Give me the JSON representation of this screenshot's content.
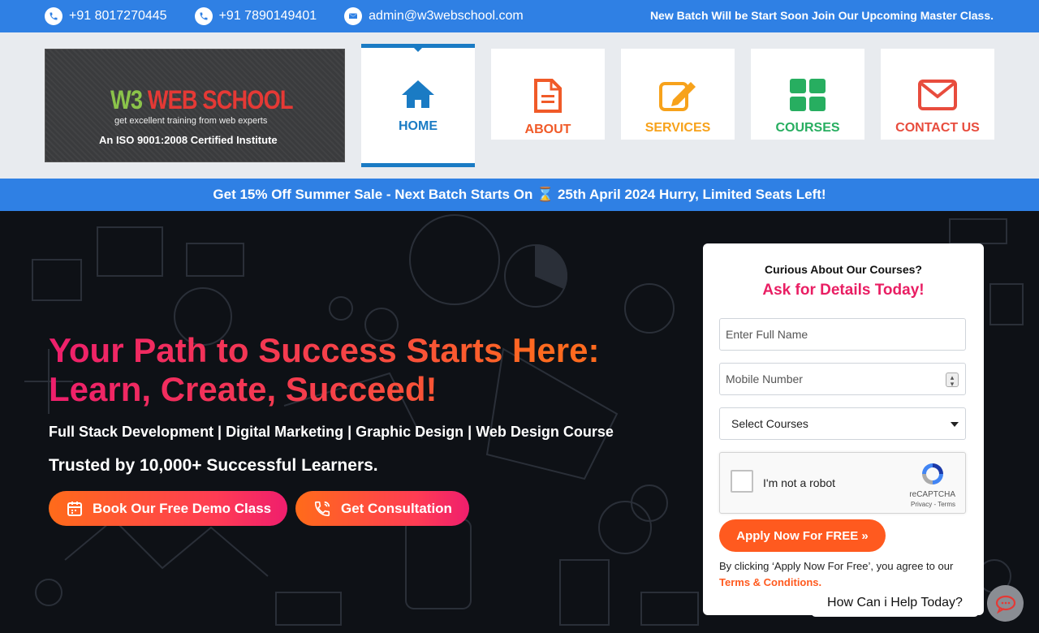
{
  "topbar": {
    "phone1": "+91 8017270445",
    "phone2": "+91 7890149401",
    "email": "admin@w3webschool.com",
    "announcement": "New Batch Will be Start Soon Join Our Upcoming Master Class."
  },
  "logo": {
    "brand_w3": "W3",
    "brand_rest": " WEB SCHOOL",
    "tagline": "get excellent training from web experts",
    "iso": "An ISO 9001:2008 Certified Institute"
  },
  "nav": {
    "items": [
      {
        "label": "HOME",
        "icon": "home-icon",
        "color": "#1a7bc4",
        "active": true
      },
      {
        "label": "ABOUT",
        "icon": "document-icon",
        "color": "#f05a28"
      },
      {
        "label": "SERVICES",
        "icon": "edit-icon",
        "color": "#f7a21b"
      },
      {
        "label": "COURSES",
        "icon": "grid-icon",
        "color": "#27ae60"
      },
      {
        "label": "CONTACT US",
        "icon": "envelope-icon",
        "color": "#e84c3d"
      }
    ]
  },
  "promo": {
    "text": "Get 15% Off Summer Sale - Next Batch Starts On ⌛ 25th April 2024 Hurry, Limited Seats Left!"
  },
  "hero": {
    "headline_line1": "Your Path to Success Starts Here:",
    "headline_line2": "Learn, Create, Succeed!",
    "subline": "Full Stack Development | Digital Marketing | Graphic Design | Web Design Course",
    "trusted": "Trusted by 10,000+ Successful Learners.",
    "demo_button": "Book Our Free Demo Class",
    "consult_button": "Get Consultation"
  },
  "form": {
    "question": "Curious About Our Courses?",
    "ask": "Ask for Details Today!",
    "name_placeholder": "Enter Full Name",
    "mobile_placeholder": "Mobile Number",
    "course_selected": "Select Courses",
    "captcha_label": "I'm not a robot",
    "captcha_brand": "reCAPTCHA",
    "captcha_terms": "Privacy - Terms",
    "apply_button": "Apply Now For FREE »",
    "agree_text": "By clicking ‘Apply Now For Free’, you agree to our",
    "terms_link": "Terms & Conditions."
  },
  "chat": {
    "bubble": "How Can i Help Today?"
  },
  "colors": {
    "topbar": "#2f80e4",
    "accent_orange": "#ff5a1f",
    "accent_pink": "#e91e63"
  }
}
